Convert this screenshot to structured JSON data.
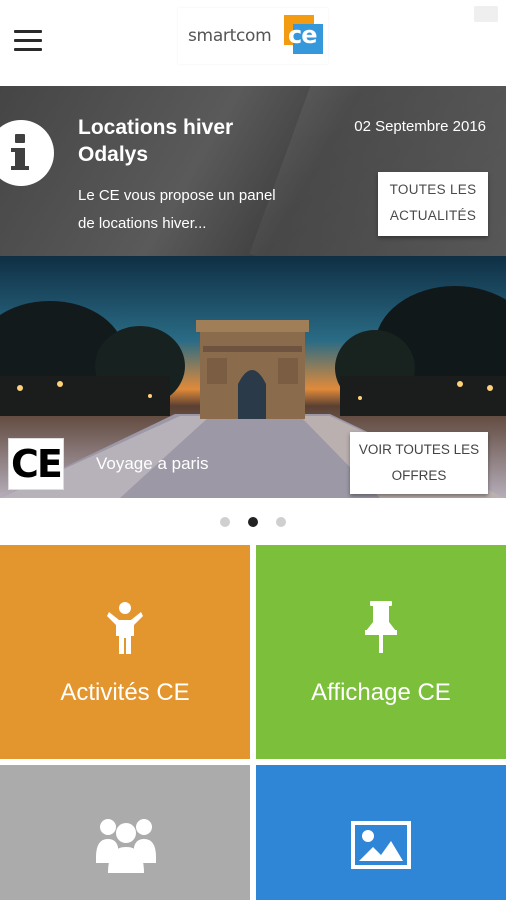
{
  "header": {
    "logo": {
      "text": "smartcom",
      "badge": "ce"
    }
  },
  "news": {
    "title": "Locations hiver Odalys",
    "date": "02 Septembre 2016",
    "excerpt": "Le CE vous propose un panel de locations hiver...",
    "button_label": "TOUTES LES ACTUALITÉS"
  },
  "offer": {
    "badge": "CE",
    "caption": "Voyage a paris",
    "button_label": "VOIR TOUTES LES OFFRES"
  },
  "pager": {
    "count": 3,
    "active_index": 1
  },
  "tiles": [
    {
      "label": "Activités CE",
      "icon": "person-icon",
      "color": "#e3952e"
    },
    {
      "label": "Affichage CE",
      "icon": "pushpin-icon",
      "color": "#7bbf3a"
    },
    {
      "label": "",
      "icon": "group-icon",
      "color": "#ababab"
    },
    {
      "label": "",
      "icon": "image-icon",
      "color": "#2f86d6"
    }
  ],
  "colors": {
    "news_bg": "#4b4b4b",
    "activites": "#e3952e",
    "affichage": "#7bbf3a",
    "group_tile": "#ababab",
    "gallery_tile": "#2f86d6"
  }
}
